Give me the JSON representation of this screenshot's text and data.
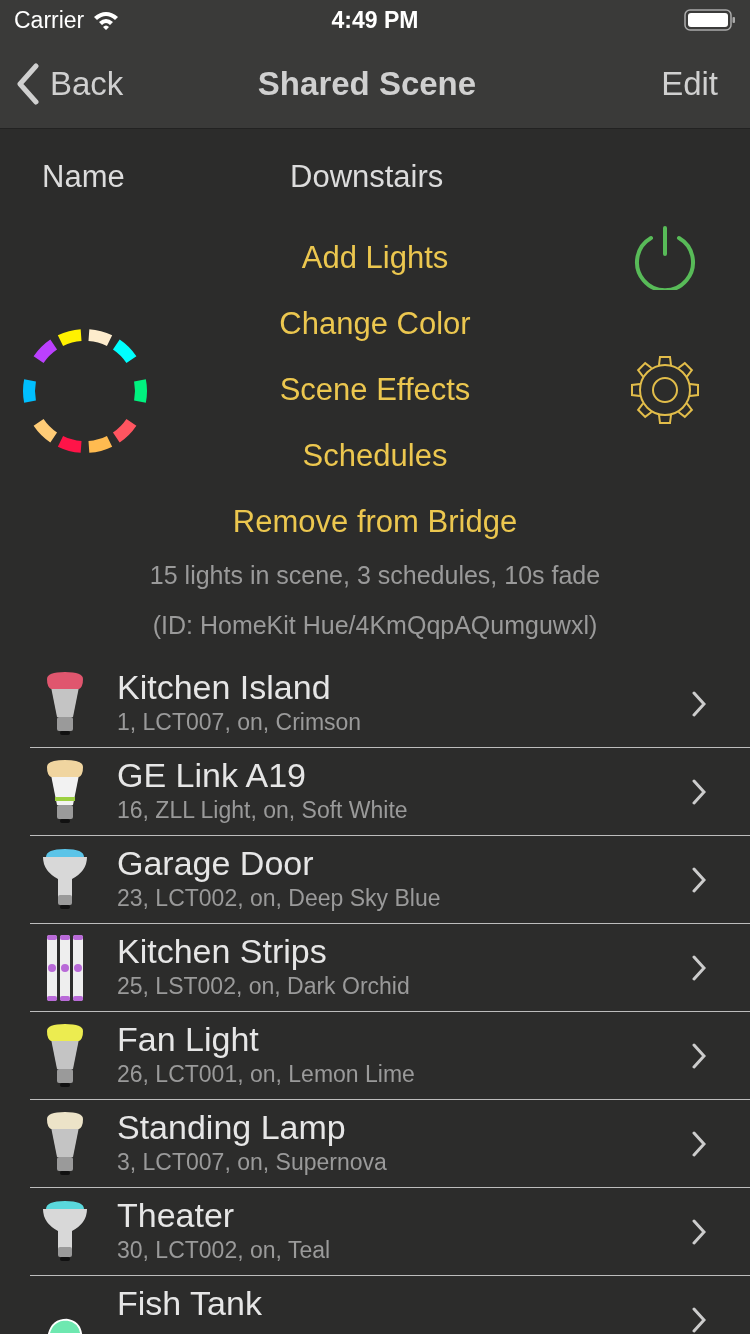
{
  "status_bar": {
    "carrier": "Carrier",
    "time": "4:49 PM"
  },
  "nav": {
    "back": "Back",
    "title": "Shared Scene",
    "action": "Edit"
  },
  "name_row": {
    "label": "Name",
    "value": "Downstairs"
  },
  "power": {
    "on": true
  },
  "actions": [
    "Add Lights",
    "Change Color",
    "Scene Effects",
    "Schedules"
  ],
  "remove": "Remove from Bridge",
  "summary": "15 lights in scene, 3 schedules, 10s fade",
  "scene_id": "(ID: HomeKit Hue/4KmQqpAQumguwxl)",
  "lights": [
    {
      "name": "Kitchen Island",
      "detail": "1, LCT007, on, Crimson",
      "kind": "bulb",
      "color": "#e0566e"
    },
    {
      "name": "GE Link A19",
      "detail": "16, ZLL Light, on, Soft White",
      "kind": "ge",
      "color": "#f0d5a0"
    },
    {
      "name": "Garage Door",
      "detail": "23, LCT002, on, Deep Sky Blue",
      "kind": "flood",
      "color": "#5bc4e8"
    },
    {
      "name": "Kitchen Strips",
      "detail": "25, LST002, on, Dark Orchid",
      "kind": "strip",
      "color": "#b96ad8"
    },
    {
      "name": "Fan Light",
      "detail": "26, LCT001, on, Lemon Lime",
      "kind": "bulb",
      "color": "#ecec50"
    },
    {
      "name": "Standing Lamp",
      "detail": "3, LCT007, on, Supernova",
      "kind": "bulb",
      "color": "#ece3c8"
    },
    {
      "name": "Theater",
      "detail": "30, LCT002, on, Teal",
      "kind": "flood",
      "color": "#5ad8dc"
    },
    {
      "name": "Fish Tank",
      "kind": "bloom",
      "color": "#6ee8b0"
    }
  ]
}
